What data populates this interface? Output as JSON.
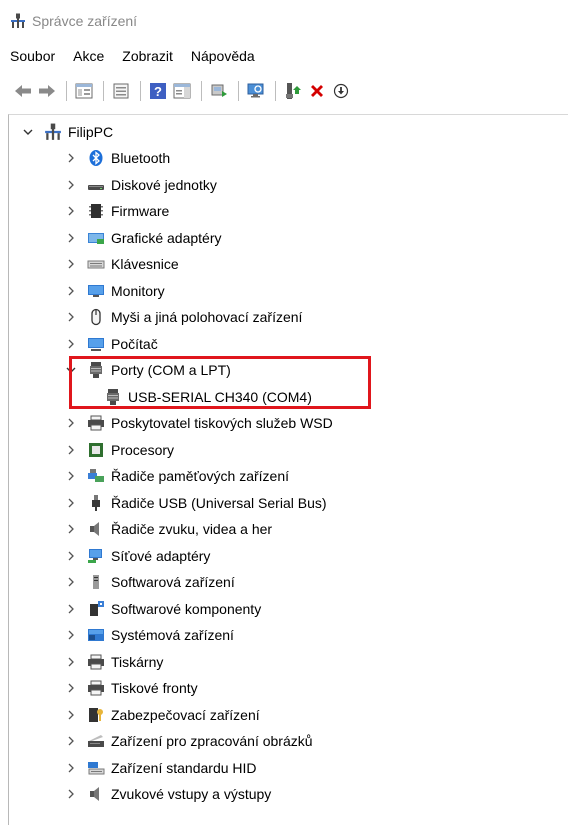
{
  "window": {
    "title": "Správce zařízení"
  },
  "menu": [
    "Soubor",
    "Akce",
    "Zobrazit",
    "Nápověda"
  ],
  "toolbar": {
    "buttons": [
      "back-icon",
      "forward-icon",
      "properties-icon",
      "console-tree-icon",
      "help-icon",
      "action-pane-icon",
      "update-driver-icon",
      "scan-hardware-icon",
      "enable-device-icon",
      "uninstall-icon",
      "install-icon"
    ],
    "colors": {
      "uninstall": "#d40000",
      "enable": "#2e7d32"
    }
  },
  "tree": {
    "root": "FilipPC",
    "items": [
      {
        "label": "Bluetooth",
        "icon": "bluetooth-icon",
        "expanded": false
      },
      {
        "label": "Diskové jednotky",
        "icon": "disk-drive-icon",
        "expanded": false
      },
      {
        "label": "Firmware",
        "icon": "firmware-icon",
        "expanded": false
      },
      {
        "label": "Grafické adaptéry",
        "icon": "display-adapter-icon",
        "expanded": false
      },
      {
        "label": "Klávesnice",
        "icon": "keyboard-icon",
        "expanded": false
      },
      {
        "label": "Monitory",
        "icon": "monitor-icon",
        "expanded": false
      },
      {
        "label": "Myši a jiná polohovací zařízení",
        "icon": "mouse-icon",
        "expanded": false
      },
      {
        "label": "Počítač",
        "icon": "computer-icon",
        "expanded": false
      },
      {
        "label": "Porty (COM a LPT)",
        "icon": "port-icon",
        "expanded": true
      },
      {
        "label": "USB-SERIAL CH340 (COM4)",
        "icon": "port-icon",
        "child": true
      },
      {
        "label": "Poskytovatel tiskových služeb WSD",
        "icon": "printer-icon",
        "expanded": false
      },
      {
        "label": "Procesory",
        "icon": "processor-icon",
        "expanded": false
      },
      {
        "label": "Řadiče paměťových zařízení",
        "icon": "storage-controller-icon",
        "expanded": false
      },
      {
        "label": "Řadiče USB (Universal Serial Bus)",
        "icon": "usb-icon",
        "expanded": false
      },
      {
        "label": "Řadiče zvuku, videa a her",
        "icon": "sound-icon",
        "expanded": false
      },
      {
        "label": "Síťové adaptéry",
        "icon": "network-adapter-icon",
        "expanded": false
      },
      {
        "label": "Softwarová zařízení",
        "icon": "software-device-icon",
        "expanded": false
      },
      {
        "label": "Softwarové komponenty",
        "icon": "software-component-icon",
        "expanded": false
      },
      {
        "label": "Systémová zařízení",
        "icon": "system-device-icon",
        "expanded": false
      },
      {
        "label": "Tiskárny",
        "icon": "printer-icon",
        "expanded": false
      },
      {
        "label": "Tiskové fronty",
        "icon": "print-queue-icon",
        "expanded": false
      },
      {
        "label": "Zabezpečovací zařízení",
        "icon": "security-device-icon",
        "expanded": false
      },
      {
        "label": "Zařízení pro zpracování obrázků",
        "icon": "imaging-device-icon",
        "expanded": false
      },
      {
        "label": "Zařízení standardu HID",
        "icon": "hid-icon",
        "expanded": false
      },
      {
        "label": "Zvukové vstupy a výstupy",
        "icon": "audio-io-icon",
        "expanded": false
      }
    ]
  },
  "highlight_color": "#e0161c"
}
